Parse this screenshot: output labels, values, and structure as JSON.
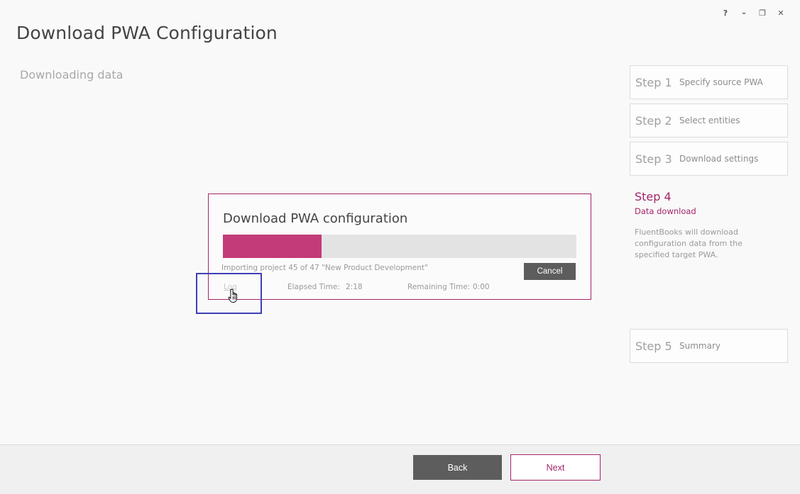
{
  "window": {
    "help": "?",
    "minimize": "–",
    "restore": "❐",
    "close": "✕"
  },
  "header": {
    "title": "Download PWA Configuration",
    "subtitle": "Downloading data"
  },
  "steps": [
    {
      "num": "Step 1",
      "label": "Specify source PWA"
    },
    {
      "num": "Step 2",
      "label": "Select entities"
    },
    {
      "num": "Step 3",
      "label": "Download settings"
    },
    {
      "num": "Step 4",
      "label": "Data download",
      "description": "FluentBooks will download configuration data from the specified target PWA."
    },
    {
      "num": "Step 5",
      "label": "Summary"
    }
  ],
  "active_step": 4,
  "dialog": {
    "title": "Download PWA configuration",
    "progress": 0.28,
    "status": "Importing project 45 of 47 \"New Product Development\"",
    "cancel_label": "Cancel",
    "log_label": "Log",
    "elapsed_label": "Elapsed Time:",
    "elapsed_value": "2:18",
    "remaining_label": "Remaining Time:",
    "remaining_value": "0:00"
  },
  "footer": {
    "back_label": "Back",
    "next_label": "Next"
  },
  "colors": {
    "accent": "#a3256a",
    "progress": "#c33b78",
    "dark_button": "#5d5d5d",
    "highlight": "#3f3fb5"
  }
}
